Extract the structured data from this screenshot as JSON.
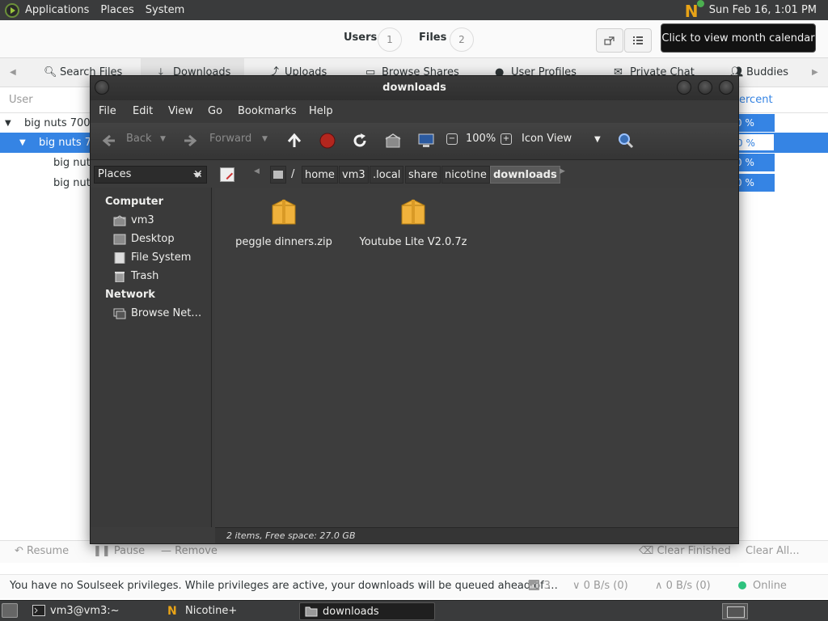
{
  "top_panel": {
    "menus": [
      "Applications",
      "Places",
      "System"
    ],
    "clock": "Sun Feb 16,  1:01 PM"
  },
  "tooltip": "Click to view month calendar",
  "nicotine": {
    "header": {
      "users_label": "Users",
      "users_count": "1",
      "files_label": "Files",
      "files_count": "2"
    },
    "tabs": [
      {
        "label": "Search Files"
      },
      {
        "label": "Downloads"
      },
      {
        "label": "Uploads"
      },
      {
        "label": "Browse Shares"
      },
      {
        "label": "User Profiles"
      },
      {
        "label": "Private Chat"
      },
      {
        "label": "Buddies"
      }
    ],
    "columns": {
      "user": "User",
      "percent": "ercent"
    },
    "rows": [
      {
        "label": "big nuts 700",
        "pct": "0 %"
      },
      {
        "label": "big nuts 70",
        "pct": "0 %"
      },
      {
        "label": "big nuts",
        "pct": "0 %"
      },
      {
        "label": "big nuts",
        "pct": "0 %"
      }
    ],
    "actions": {
      "resume": "Resume",
      "pause": "Pause",
      "remove": "Remove",
      "clear_finished": "Clear Finished",
      "clear_all": "Clear All..."
    },
    "status": {
      "message": "You have no Soulseek privileges. While privileges are active, your downloads will be queued ahead of …",
      "connections": "3",
      "down_speed": "0 B/s (0)",
      "up_speed": "0 B/s (0)",
      "online": "Online"
    }
  },
  "file_manager": {
    "title": "downloads",
    "menu": [
      "File",
      "Edit",
      "View",
      "Go",
      "Bookmarks",
      "Help"
    ],
    "toolbar": {
      "back": "Back",
      "forward": "Forward",
      "zoom": "100%",
      "view_mode": "Icon View"
    },
    "places_select": "Places",
    "path": {
      "root_sep": "/",
      "crumbs": [
        "home",
        "vm3",
        ".local",
        "share",
        "nicotine",
        "downloads"
      ]
    },
    "sidebar": {
      "computer_header": "Computer",
      "computer_items": [
        "vm3",
        "Desktop",
        "File System",
        "Trash"
      ],
      "network_header": "Network",
      "network_items": [
        "Browse Net…"
      ]
    },
    "files": [
      {
        "name": "peggle dinners.zip"
      },
      {
        "name": "Youtube Lite V2.0.7z"
      }
    ],
    "status": "2 items, Free space: 27.0 GB"
  },
  "taskbar": {
    "tasks": [
      {
        "label": "vm3@vm3:~"
      },
      {
        "label": "Nicotine+"
      },
      {
        "label": "downloads"
      }
    ]
  },
  "colors": {
    "accent": "#3584e4",
    "panel": "#3a3b3c",
    "folder": "#f0b23c",
    "online": "#2ec27e"
  }
}
